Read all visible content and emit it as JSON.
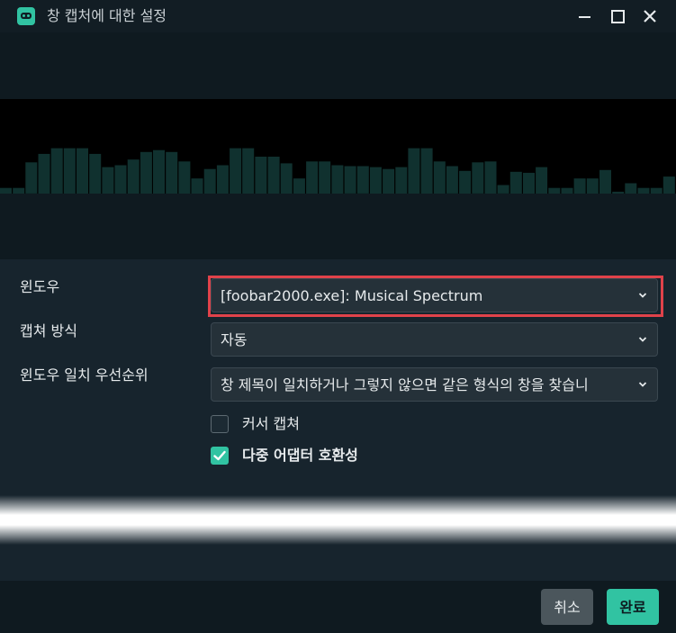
{
  "window": {
    "title": "창 캡처에 대한 설정",
    "icons": {
      "app": "streamlabs-icon",
      "minimize": "minimize-icon",
      "maximize": "maximize-icon",
      "close": "close-icon"
    }
  },
  "colors": {
    "accent": "#31c3a2",
    "highlight": "#e0424a",
    "background": "#17242d"
  },
  "preview": {
    "bar_levels": [
      0.06,
      0.06,
      0.33,
      0.42,
      0.48,
      0.48,
      0.48,
      0.42,
      0.28,
      0.3,
      0.36,
      0.44,
      0.46,
      0.44,
      0.34,
      0.16,
      0.26,
      0.3,
      0.48,
      0.48,
      0.39,
      0.39,
      0.32,
      0.16,
      0.34,
      0.34,
      0.3,
      0.29,
      0.29,
      0.28,
      0.26,
      0.28,
      0.48,
      0.48,
      0.34,
      0.29,
      0.24,
      0.33,
      0.34,
      0.09,
      0.23,
      0.22,
      0.28,
      0.06,
      0.06,
      0.16,
      0.16,
      0.25,
      0.02,
      0.11,
      0.06,
      0.06,
      0.18
    ]
  },
  "settings": {
    "window_label": "윈도우",
    "window_value": "[foobar2000.exe]: Musical Spectrum",
    "capture_method_label": "캡쳐 방식",
    "capture_method_value": "자동",
    "priority_label": "윈도우 일치 우선순위",
    "priority_value": "창 제목이 일치하거나 그렇지 않으면 같은 형식의 창을 찾습니",
    "capture_cursor_label": "커서 캡쳐",
    "capture_cursor_checked": false,
    "multi_adapter_label": "다중 어댑터 호환성",
    "multi_adapter_checked": true
  },
  "footer": {
    "cancel_label": "취소",
    "done_label": "완료"
  }
}
